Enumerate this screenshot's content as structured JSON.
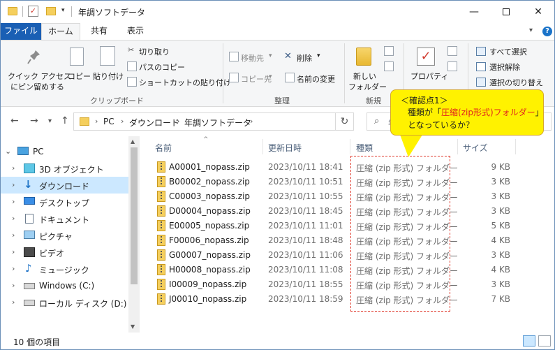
{
  "window": {
    "title": "年調ソフトデータ"
  },
  "ribbon_tabs": [
    "ファイル",
    "ホーム",
    "共有",
    "表示"
  ],
  "ribbon": {
    "clipboard": {
      "pin_label": "クイック アクセス\nにピン留めする",
      "pin_l1": "クイック アクセス",
      "pin_l2": "にピン留めする",
      "copy": "コピー",
      "paste": "貼り付け",
      "cut": "切り取り",
      "copy_path": "パスのコピー",
      "paste_shortcut": "ショートカットの貼り付け",
      "group": "クリップボード"
    },
    "organize": {
      "move_to": "移動先",
      "copy_to": "コピー先",
      "delete": "削除",
      "rename": "名前の変更",
      "group": "整理"
    },
    "new": {
      "new_folder_l1": "新しい",
      "new_folder_l2": "フォルダー",
      "group": "新規"
    },
    "open": {
      "properties": "プロパティ"
    },
    "select": {
      "select_all": "すべて選択",
      "select_none": "選択解除",
      "invert": "選択の切り替え"
    }
  },
  "address": {
    "crumbs": [
      "PC",
      "ダウンロード",
      "年調ソフトデータ"
    ],
    "search_placeholder": "年調"
  },
  "nav_pane": [
    {
      "label": "PC",
      "icon": "pc-icon",
      "top": true
    },
    {
      "label": "3D オブジェクト",
      "icon": "3d-objects-icon"
    },
    {
      "label": "ダウンロード",
      "icon": "download-icon",
      "selected": true
    },
    {
      "label": "デスクトップ",
      "icon": "desktop-icon"
    },
    {
      "label": "ドキュメント",
      "icon": "documents-icon"
    },
    {
      "label": "ピクチャ",
      "icon": "pictures-icon"
    },
    {
      "label": "ビデオ",
      "icon": "videos-icon"
    },
    {
      "label": "ミュージック",
      "icon": "music-icon"
    },
    {
      "label": "Windows (C:)",
      "icon": "drive-c-icon"
    },
    {
      "label": "ローカル ディスク (D:)",
      "icon": "drive-d-icon"
    }
  ],
  "columns": {
    "name": "名前",
    "date": "更新日時",
    "type": "種類",
    "size": "サイズ"
  },
  "files": [
    {
      "name": "A00001_nopass.zip",
      "date": "2023/10/11 18:41",
      "type": "圧縮 (zip 形式) フォルダー",
      "size": "9 KB"
    },
    {
      "name": "B00002_nopass.zip",
      "date": "2023/10/11 10:51",
      "type": "圧縮 (zip 形式) フォルダー",
      "size": "3 KB"
    },
    {
      "name": "C00003_nopass.zip",
      "date": "2023/10/11 10:55",
      "type": "圧縮 (zip 形式) フォルダー",
      "size": "3 KB"
    },
    {
      "name": "D00004_nopass.zip",
      "date": "2023/10/11 18:45",
      "type": "圧縮 (zip 形式) フォルダー",
      "size": "3 KB"
    },
    {
      "name": "E00005_nopass.zip",
      "date": "2023/10/11 11:01",
      "type": "圧縮 (zip 形式) フォルダー",
      "size": "5 KB"
    },
    {
      "name": "F00006_nopass.zip",
      "date": "2023/10/11 18:48",
      "type": "圧縮 (zip 形式) フォルダー",
      "size": "4 KB"
    },
    {
      "name": "G00007_nopass.zip",
      "date": "2023/10/11 11:06",
      "type": "圧縮 (zip 形式) フォルダー",
      "size": "3 KB"
    },
    {
      "name": "H00008_nopass.zip",
      "date": "2023/10/11 11:08",
      "type": "圧縮 (zip 形式) フォルダー",
      "size": "4 KB"
    },
    {
      "name": "I00009_nopass.zip",
      "date": "2023/10/11 18:55",
      "type": "圧縮 (zip 形式) フォルダー",
      "size": "3 KB"
    },
    {
      "name": "J00010_nopass.zip",
      "date": "2023/10/11 18:59",
      "type": "圧縮 (zip 形式) フォルダー",
      "size": "7 KB"
    }
  ],
  "status": {
    "item_count": "10 個の項目"
  },
  "callout": {
    "line1": "＜確認点1＞",
    "line2_pre": "種類が「",
    "line2_red": "圧縮(zip形式)フォルダー",
    "line2_post": "」",
    "line3": "となっているか？"
  },
  "colors": {
    "accent": "#1a5fb4",
    "selection": "#cce8ff",
    "callout": "#fff200",
    "highlight_red": "#e02020"
  }
}
